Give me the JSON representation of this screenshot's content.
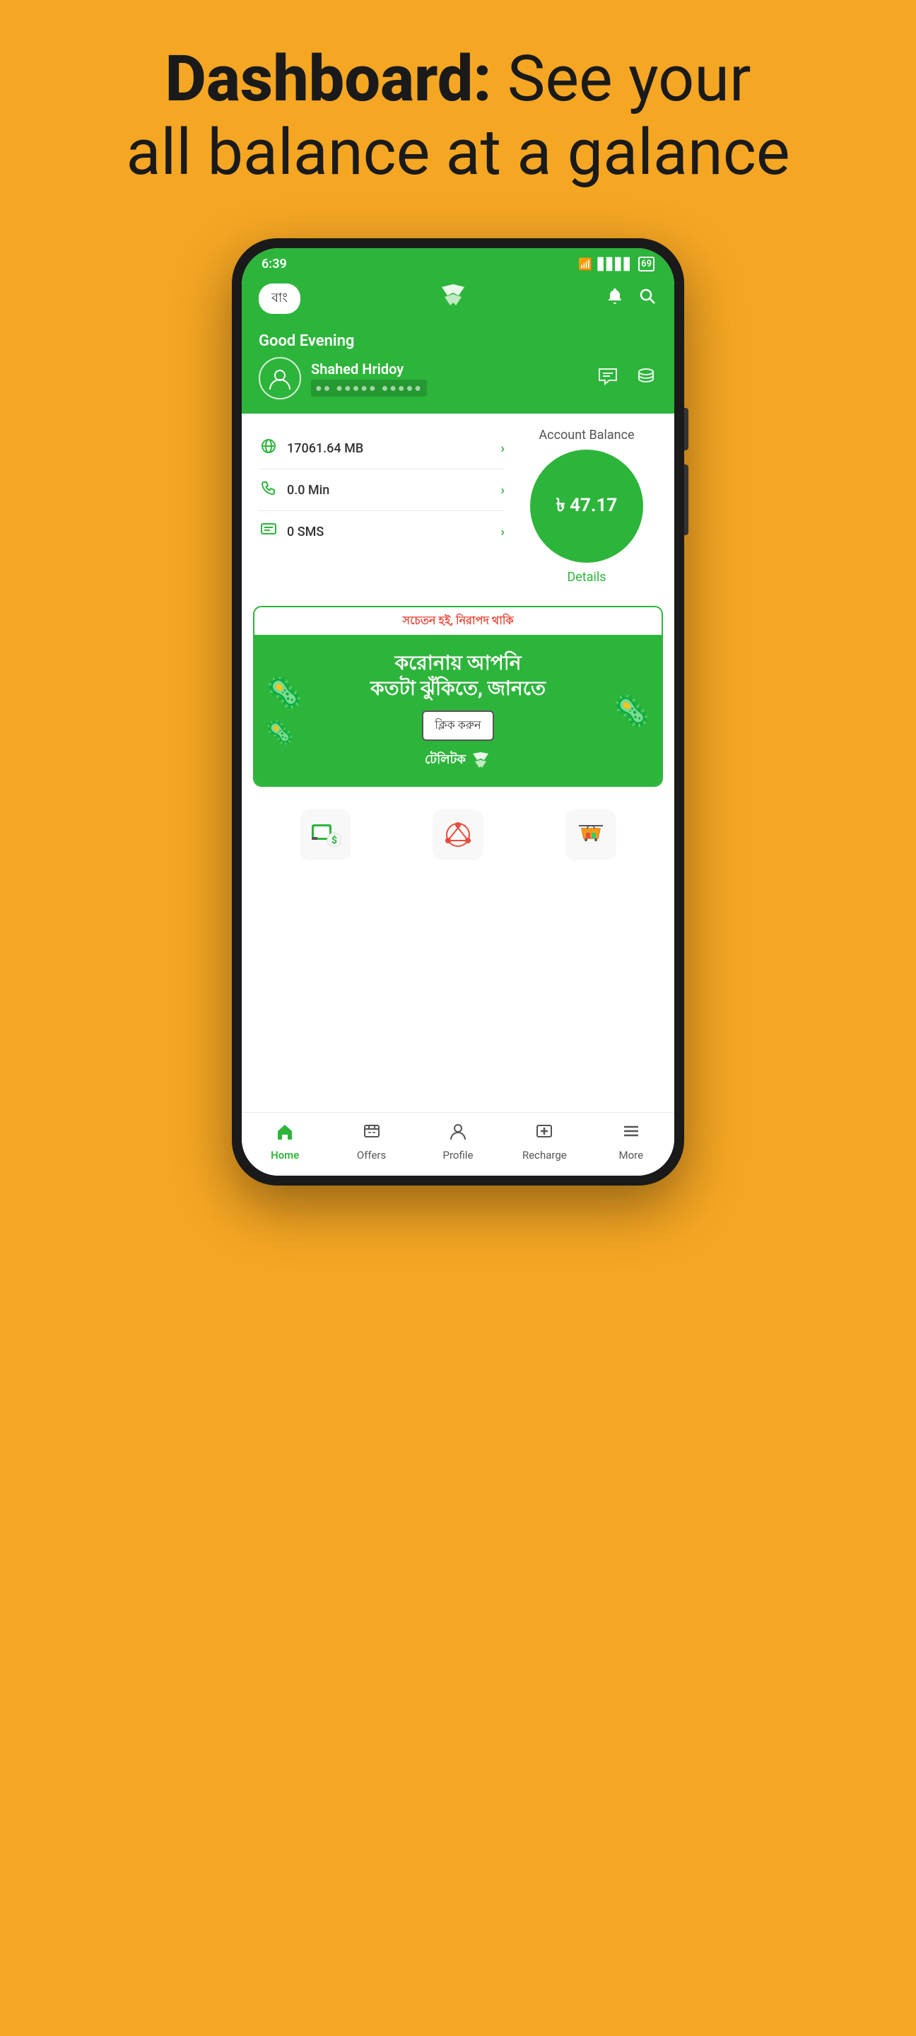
{
  "page": {
    "background_color": "#F5A623",
    "header": {
      "line1": "Dashboard:",
      "line2": "See your",
      "line3": "all balance at a galance"
    }
  },
  "statusBar": {
    "time": "6:39",
    "battery": "69",
    "signal": "●●●●",
    "wifi": "wifi"
  },
  "appHeader": {
    "lang": "বাং",
    "logo": "≋",
    "bell": "🔔",
    "search": "🔍"
  },
  "userSection": {
    "greeting": "Good Evening",
    "name": "Shahed Hridoy",
    "phone_masked": "●● ●●●●● ●●●●●",
    "chat_icon": "💬",
    "coins_icon": "🪙"
  },
  "balanceSection": {
    "items": [
      {
        "icon": "🌐",
        "label": "17061.64 MB"
      },
      {
        "icon": "📞",
        "label": "0.0 Min"
      },
      {
        "icon": "💬",
        "label": "0 SMS"
      }
    ],
    "accountBalanceLabel": "Account Balance",
    "balance": "৳ 47.17",
    "detailsLabel": "Details"
  },
  "banner": {
    "top_text": "সচেতন হই, নিরাপদ থাকি",
    "title_line1": "করোনায় আপনি",
    "title_line2": "কতটা ঝুঁকিতে, জানতে",
    "button_label": "ক্লিক করুন",
    "brand": "টেলিটক"
  },
  "quickActions": [
    {
      "icon": "💵",
      "label": ""
    },
    {
      "icon": "🔗",
      "label": ""
    },
    {
      "icon": "🛍️",
      "label": ""
    }
  ],
  "bottomNav": {
    "items": [
      {
        "icon": "🏠",
        "label": "Home",
        "active": true
      },
      {
        "icon": "🎁",
        "label": "Offers",
        "active": false
      },
      {
        "icon": "👤",
        "label": "Profile",
        "active": false
      },
      {
        "icon": "🔄",
        "label": "Recharge",
        "active": false
      },
      {
        "icon": "☰",
        "label": "More",
        "active": false
      }
    ]
  }
}
